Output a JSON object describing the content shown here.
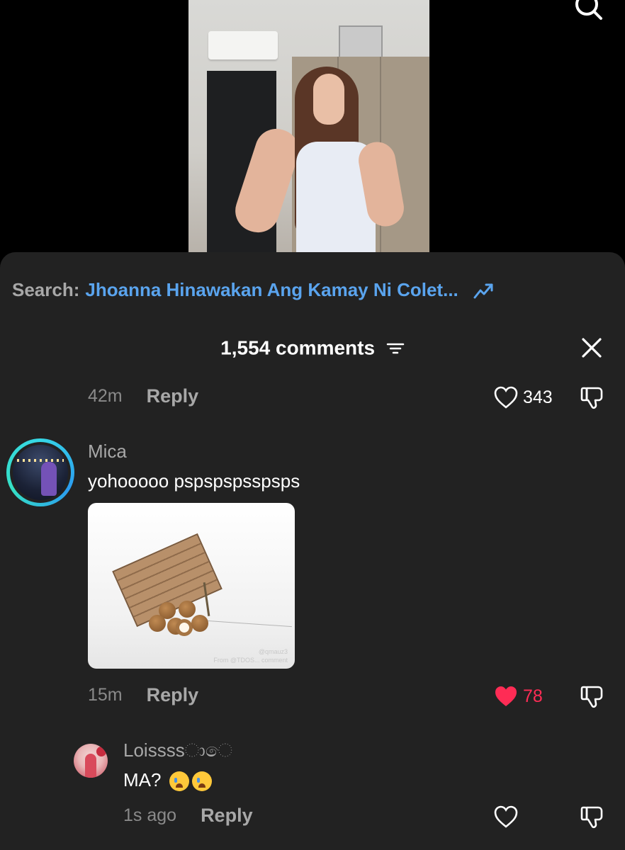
{
  "search_suggestion": {
    "prefix": "Search:",
    "term": "Jhoanna Hinawakan Ang Kamay Ni Colet..."
  },
  "comments_panel": {
    "count_label": "1,554 comments"
  },
  "comments": [
    {
      "time": "42m",
      "reply_label": "Reply",
      "likes": "343",
      "liked": false
    },
    {
      "username": "Mica",
      "text": "yohooooo pspspspsspsps",
      "attachment_watermark": "@qmauz3\nFrom @TDOS... comment",
      "time": "15m",
      "reply_label": "Reply",
      "likes": "78",
      "liked": true,
      "accent_color": "#fe2c55"
    },
    {
      "username": "Loissssාෙ",
      "text": "MA?",
      "emoji": "loudly-crying-face x2",
      "time": "1s ago",
      "reply_label": "Reply",
      "liked": false
    }
  ],
  "colors": {
    "sheet_background": "#222222",
    "search_link": "#5aa4ee",
    "liked_heart": "#fe2c55",
    "muted_text": "#a8a8a8"
  }
}
